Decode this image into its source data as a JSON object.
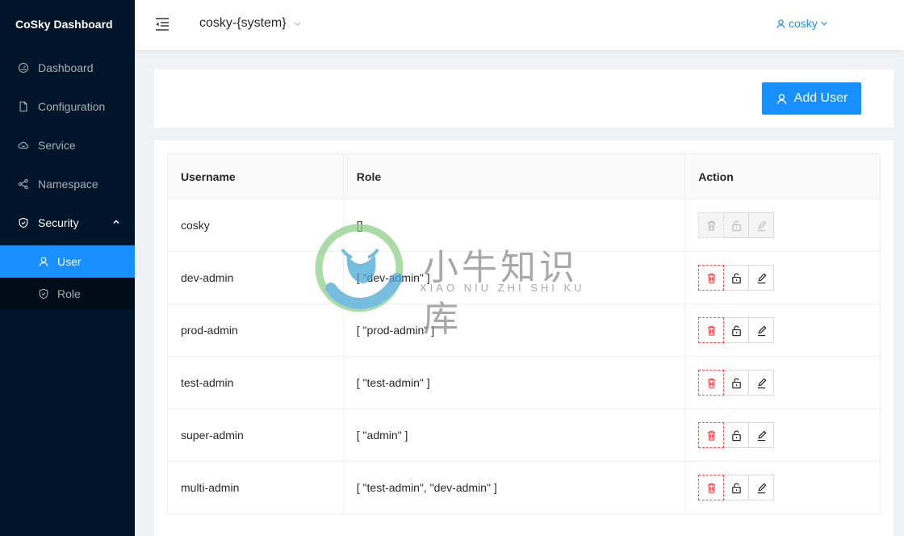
{
  "app": {
    "title": "CoSky Dashboard"
  },
  "sidebar": {
    "items": [
      {
        "label": "Dashboard",
        "icon": "dashboard-icon"
      },
      {
        "label": "Configuration",
        "icon": "file-icon"
      },
      {
        "label": "Service",
        "icon": "cloud-icon"
      },
      {
        "label": "Namespace",
        "icon": "cluster-icon"
      },
      {
        "label": "Security",
        "icon": "shield-icon",
        "open": true,
        "children": [
          {
            "label": "User",
            "icon": "user-icon",
            "active": true
          },
          {
            "label": "Role",
            "icon": "shield-icon"
          }
        ]
      }
    ]
  },
  "header": {
    "namespace": "cosky-{system}",
    "username": "cosky"
  },
  "toolbar": {
    "add_user_label": "Add User"
  },
  "table": {
    "columns": [
      "Username",
      "Role",
      "Action"
    ],
    "rows": [
      {
        "username": "cosky",
        "role": "[]",
        "actions_disabled": true
      },
      {
        "username": "dev-admin",
        "role": "[ \"dev-admin\" ]",
        "actions_disabled": false
      },
      {
        "username": "prod-admin",
        "role": "[ \"prod-admin\" ]",
        "actions_disabled": false
      },
      {
        "username": "test-admin",
        "role": "[ \"test-admin\" ]",
        "actions_disabled": false
      },
      {
        "username": "super-admin",
        "role": "[ \"admin\" ]",
        "actions_disabled": false
      },
      {
        "username": "multi-admin",
        "role": "[ \"test-admin\", \"dev-admin\" ]",
        "actions_disabled": false
      }
    ]
  },
  "watermark": {
    "title": "小牛知识库",
    "subtitle": "XIAO NIU ZHI SHI KU"
  },
  "colors": {
    "primary": "#1890ff",
    "sider": "#001529",
    "danger": "#ff4d4f"
  }
}
